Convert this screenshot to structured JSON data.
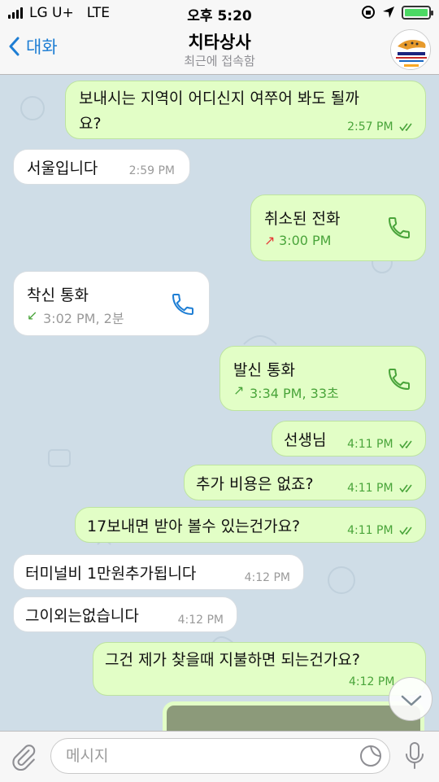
{
  "status_bar": {
    "carrier": "LG U+",
    "network": "LTE",
    "time": "오후 5:20"
  },
  "header": {
    "back_label": "대화",
    "title": "치타상사",
    "subtitle": "최근에 접속함",
    "avatar_icon": "cheetah-logo-icon"
  },
  "messages": [
    {
      "dir": "out",
      "text_line1": "보내시는 지역이 어디신지 여쭈어 봐도 될까",
      "text_line2": "요?",
      "time": "2:57 PM"
    },
    {
      "dir": "in",
      "text": "서울입니다",
      "time": "2:59 PM"
    },
    {
      "dir": "out",
      "type": "call",
      "title": "취소된 전화",
      "detail": "3:00 PM",
      "arrow": "↗"
    },
    {
      "dir": "in",
      "type": "call",
      "title": "착신 통화",
      "detail": "3:02 PM, 2분",
      "arrow": "↙"
    },
    {
      "dir": "out",
      "type": "call",
      "title": "발신 통화",
      "detail": "3:34 PM, 33초",
      "arrow": "↗"
    },
    {
      "dir": "out",
      "text": "선생님",
      "time": "4:11 PM"
    },
    {
      "dir": "out",
      "text": "추가 비용은 없죠?",
      "time": "4:11 PM"
    },
    {
      "dir": "out",
      "text": "17보내면 받아 볼수 있는건가요?",
      "time": "4:11 PM"
    },
    {
      "dir": "in",
      "text": "터미널비 1만원추가됩니다",
      "time": "4:12 PM"
    },
    {
      "dir": "in",
      "text": "그이외는없습니다",
      "time": "4:12 PM"
    },
    {
      "dir": "out",
      "text": "그건 제가 찾을때 지불하면 되는건가요?",
      "time": "4:12 PM"
    }
  ],
  "input": {
    "placeholder": "메시지"
  },
  "colors": {
    "outgoing_bubble": "#e2fec6",
    "incoming_bubble": "#ffffff",
    "accent": "#1e7ed4",
    "timestamp_green": "#49a43a",
    "missed_red": "#e53935"
  }
}
